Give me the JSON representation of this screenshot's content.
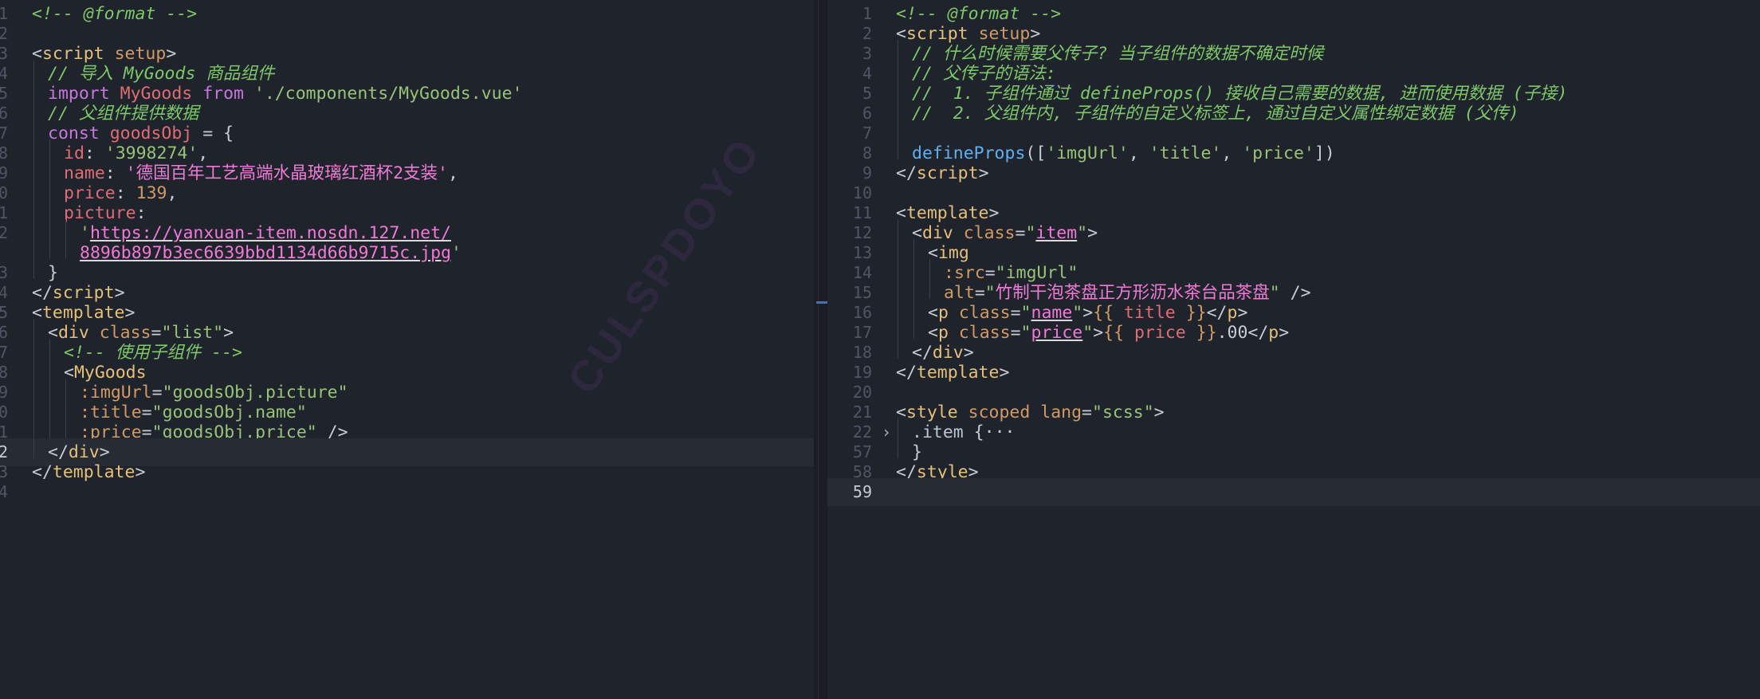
{
  "left_editor": {
    "lines": [
      {
        "num": "1",
        "indent": 0,
        "tokens": [
          {
            "t": "<!-- @format -->",
            "c": "cm"
          }
        ]
      },
      {
        "num": "2",
        "indent": 0,
        "tokens": []
      },
      {
        "num": "3",
        "indent": 0,
        "tokens": [
          {
            "t": "<",
            "c": "pn"
          },
          {
            "t": "script",
            "c": "tg"
          },
          {
            "t": " ",
            "c": "pn"
          },
          {
            "t": "setup",
            "c": "at"
          },
          {
            "t": ">",
            "c": "pn"
          }
        ]
      },
      {
        "num": "4",
        "indent": 1,
        "tokens": [
          {
            "t": "// 导入 MyGoods 商品组件",
            "c": "cm"
          }
        ]
      },
      {
        "num": "5",
        "indent": 1,
        "tokens": [
          {
            "t": "import",
            "c": "kw"
          },
          {
            "t": " ",
            "c": "pn"
          },
          {
            "t": "MyGoods",
            "c": "pr"
          },
          {
            "t": " ",
            "c": "pn"
          },
          {
            "t": "from",
            "c": "kw"
          },
          {
            "t": " ",
            "c": "pn"
          },
          {
            "t": "'./components/MyGoods.vue'",
            "c": "st"
          }
        ]
      },
      {
        "num": "6",
        "indent": 1,
        "tokens": [
          {
            "t": "// 父组件提供数据",
            "c": "cm"
          }
        ]
      },
      {
        "num": "7",
        "indent": 1,
        "tokens": [
          {
            "t": "const",
            "c": "kw"
          },
          {
            "t": " ",
            "c": "pn"
          },
          {
            "t": "goodsObj",
            "c": "pr"
          },
          {
            "t": " = {",
            "c": "pn"
          }
        ]
      },
      {
        "num": "8",
        "indent": 2,
        "tokens": [
          {
            "t": "id",
            "c": "pr"
          },
          {
            "t": ": ",
            "c": "pn"
          },
          {
            "t": "'3998274'",
            "c": "st"
          },
          {
            "t": ",",
            "c": "pn"
          }
        ]
      },
      {
        "num": "9",
        "indent": 2,
        "tokens": [
          {
            "t": "name",
            "c": "pr"
          },
          {
            "t": ": ",
            "c": "pn"
          },
          {
            "t": "'德国百年工艺高端水晶玻璃红酒杯2支装'",
            "c": "sp"
          },
          {
            "t": ",",
            "c": "pn"
          }
        ]
      },
      {
        "num": "0",
        "indent": 2,
        "tokens": [
          {
            "t": "price",
            "c": "pr"
          },
          {
            "t": ": ",
            "c": "pn"
          },
          {
            "t": "139",
            "c": "nu"
          },
          {
            "t": ",",
            "c": "pn"
          }
        ]
      },
      {
        "num": "1",
        "indent": 2,
        "tokens": [
          {
            "t": "picture",
            "c": "pr"
          },
          {
            "t": ":",
            "c": "pn"
          }
        ]
      },
      {
        "num": "2",
        "indent": 3,
        "tokens": [
          {
            "t": "'",
            "c": "st"
          },
          {
            "t": "https://yanxuan-item.nosdn.127.net/",
            "c": "sp ul"
          }
        ]
      },
      {
        "num": "",
        "indent": 3,
        "tokens": [
          {
            "t": "8896b897b3ec6639bbd1134d66b9715c.jpg",
            "c": "sp ul"
          },
          {
            "t": "'",
            "c": "st"
          }
        ]
      },
      {
        "num": "3",
        "indent": 1,
        "tokens": [
          {
            "t": "}",
            "c": "pn"
          }
        ]
      },
      {
        "num": "4",
        "indent": 0,
        "tokens": [
          {
            "t": "</",
            "c": "pn"
          },
          {
            "t": "script",
            "c": "tg"
          },
          {
            "t": ">",
            "c": "pn"
          }
        ]
      },
      {
        "num": "5",
        "indent": 0,
        "tokens": [
          {
            "t": "<",
            "c": "pn"
          },
          {
            "t": "template",
            "c": "tg"
          },
          {
            "t": ">",
            "c": "pn"
          }
        ]
      },
      {
        "num": "6",
        "indent": 1,
        "tokens": [
          {
            "t": "<",
            "c": "pn"
          },
          {
            "t": "div",
            "c": "tg"
          },
          {
            "t": " ",
            "c": "pn"
          },
          {
            "t": "class",
            "c": "at"
          },
          {
            "t": "=",
            "c": "pn"
          },
          {
            "t": "\"list\"",
            "c": "st"
          },
          {
            "t": ">",
            "c": "pn"
          }
        ]
      },
      {
        "num": "7",
        "indent": 2,
        "tokens": [
          {
            "t": "<!-- 使用子组件 -->",
            "c": "cm"
          }
        ]
      },
      {
        "num": "8",
        "indent": 2,
        "tokens": [
          {
            "t": "<",
            "c": "pn"
          },
          {
            "t": "MyGoods",
            "c": "tg"
          }
        ]
      },
      {
        "num": "9",
        "indent": 3,
        "tokens": [
          {
            "t": ":imgUrl",
            "c": "at"
          },
          {
            "t": "=",
            "c": "pn"
          },
          {
            "t": "\"goodsObj.picture\"",
            "c": "st"
          }
        ]
      },
      {
        "num": "0",
        "indent": 3,
        "tokens": [
          {
            "t": ":title",
            "c": "at"
          },
          {
            "t": "=",
            "c": "pn"
          },
          {
            "t": "\"goodsObj.name\"",
            "c": "st"
          }
        ]
      },
      {
        "num": "1",
        "indent": 3,
        "tokens": [
          {
            "t": ":price",
            "c": "at"
          },
          {
            "t": "=",
            "c": "pn"
          },
          {
            "t": "\"goodsObj.price\"",
            "c": "st"
          },
          {
            "t": " />",
            "c": "pn"
          }
        ]
      },
      {
        "num": "2",
        "indent": 1,
        "current": true,
        "tokens": [
          {
            "t": "</",
            "c": "pn"
          },
          {
            "t": "div",
            "c": "tg"
          },
          {
            "t": ">",
            "c": "pn"
          }
        ]
      },
      {
        "num": "3",
        "indent": 0,
        "tokens": [
          {
            "t": "</",
            "c": "pn"
          },
          {
            "t": "template",
            "c": "tg"
          },
          {
            "t": ">",
            "c": "pn"
          }
        ]
      },
      {
        "num": "4",
        "indent": 0,
        "tokens": []
      }
    ]
  },
  "right_editor": {
    "lines": [
      {
        "num": "1",
        "indent": 0,
        "tokens": [
          {
            "t": "<!-- @format -->",
            "c": "cm"
          }
        ]
      },
      {
        "num": "2",
        "indent": 0,
        "tokens": [
          {
            "t": "<",
            "c": "pn"
          },
          {
            "t": "script",
            "c": "tg"
          },
          {
            "t": " ",
            "c": "pn"
          },
          {
            "t": "setup",
            "c": "at"
          },
          {
            "t": ">",
            "c": "pn"
          }
        ]
      },
      {
        "num": "3",
        "indent": 1,
        "tokens": [
          {
            "t": "// 什么时候需要父传子? 当子组件的数据不确定时候",
            "c": "cm"
          }
        ]
      },
      {
        "num": "4",
        "indent": 1,
        "tokens": [
          {
            "t": "// 父传子的语法:",
            "c": "cm"
          }
        ]
      },
      {
        "num": "5",
        "indent": 1,
        "tokens": [
          {
            "t": "//  1. 子组件通过 defineProps() 接收自己需要的数据, 进而使用数据 (子接)",
            "c": "cm"
          }
        ]
      },
      {
        "num": "6",
        "indent": 1,
        "tokens": [
          {
            "t": "//  2. 父组件内, 子组件的自定义标签上, 通过自定义属性绑定数据 (父传)",
            "c": "cm"
          }
        ]
      },
      {
        "num": "7",
        "indent": 1,
        "tokens": []
      },
      {
        "num": "8",
        "indent": 1,
        "tokens": [
          {
            "t": "defineProps",
            "c": "fn"
          },
          {
            "t": "([",
            "c": "pn"
          },
          {
            "t": "'imgUrl'",
            "c": "st"
          },
          {
            "t": ", ",
            "c": "pn"
          },
          {
            "t": "'title'",
            "c": "st"
          },
          {
            "t": ", ",
            "c": "pn"
          },
          {
            "t": "'price'",
            "c": "st"
          },
          {
            "t": "])",
            "c": "pn"
          }
        ]
      },
      {
        "num": "9",
        "indent": 0,
        "tokens": [
          {
            "t": "</",
            "c": "pn"
          },
          {
            "t": "script",
            "c": "tg"
          },
          {
            "t": ">",
            "c": "pn"
          }
        ]
      },
      {
        "num": "10",
        "indent": 0,
        "tokens": []
      },
      {
        "num": "11",
        "indent": 0,
        "tokens": [
          {
            "t": "<",
            "c": "pn"
          },
          {
            "t": "template",
            "c": "tg"
          },
          {
            "t": ">",
            "c": "pn"
          }
        ]
      },
      {
        "num": "12",
        "indent": 1,
        "tokens": [
          {
            "t": "<",
            "c": "pn"
          },
          {
            "t": "div",
            "c": "tg"
          },
          {
            "t": " ",
            "c": "pn"
          },
          {
            "t": "class",
            "c": "at"
          },
          {
            "t": "=",
            "c": "pn"
          },
          {
            "t": "\"",
            "c": "st"
          },
          {
            "t": "item",
            "c": "sp ul"
          },
          {
            "t": "\"",
            "c": "st"
          },
          {
            "t": ">",
            "c": "pn"
          }
        ]
      },
      {
        "num": "13",
        "indent": 2,
        "tokens": [
          {
            "t": "<",
            "c": "pn"
          },
          {
            "t": "img",
            "c": "tg"
          }
        ]
      },
      {
        "num": "14",
        "indent": 3,
        "tokens": [
          {
            "t": ":src",
            "c": "at"
          },
          {
            "t": "=",
            "c": "pn"
          },
          {
            "t": "\"imgUrl\"",
            "c": "st"
          }
        ]
      },
      {
        "num": "15",
        "indent": 3,
        "tokens": [
          {
            "t": "alt",
            "c": "at"
          },
          {
            "t": "=",
            "c": "pn"
          },
          {
            "t": "\"",
            "c": "st"
          },
          {
            "t": "竹制干泡茶盘正方形沥水茶台品茶盘",
            "c": "sp"
          },
          {
            "t": "\"",
            "c": "st"
          },
          {
            "t": " />",
            "c": "pn"
          }
        ]
      },
      {
        "num": "16",
        "indent": 2,
        "tokens": [
          {
            "t": "<",
            "c": "pn"
          },
          {
            "t": "p",
            "c": "tg"
          },
          {
            "t": " ",
            "c": "pn"
          },
          {
            "t": "class",
            "c": "at"
          },
          {
            "t": "=",
            "c": "pn"
          },
          {
            "t": "\"",
            "c": "st"
          },
          {
            "t": "name",
            "c": "sp ul"
          },
          {
            "t": "\"",
            "c": "st"
          },
          {
            "t": ">",
            "c": "pn"
          },
          {
            "t": "{{ ",
            "c": "at"
          },
          {
            "t": "title",
            "c": "pr"
          },
          {
            "t": " }}",
            "c": "at"
          },
          {
            "t": "</",
            "c": "pn"
          },
          {
            "t": "p",
            "c": "tg"
          },
          {
            "t": ">",
            "c": "pn"
          }
        ]
      },
      {
        "num": "17",
        "indent": 2,
        "tokens": [
          {
            "t": "<",
            "c": "pn"
          },
          {
            "t": "p",
            "c": "tg"
          },
          {
            "t": " ",
            "c": "pn"
          },
          {
            "t": "class",
            "c": "at"
          },
          {
            "t": "=",
            "c": "pn"
          },
          {
            "t": "\"",
            "c": "st"
          },
          {
            "t": "price",
            "c": "sp ul"
          },
          {
            "t": "\"",
            "c": "st"
          },
          {
            "t": ">",
            "c": "pn"
          },
          {
            "t": "{{ ",
            "c": "at"
          },
          {
            "t": "price",
            "c": "pr"
          },
          {
            "t": " }}",
            "c": "at"
          },
          {
            "t": ".00",
            "c": "pn"
          },
          {
            "t": "</",
            "c": "pn"
          },
          {
            "t": "p",
            "c": "tg"
          },
          {
            "t": ">",
            "c": "pn"
          }
        ]
      },
      {
        "num": "18",
        "indent": 1,
        "tokens": [
          {
            "t": "</",
            "c": "pn"
          },
          {
            "t": "div",
            "c": "tg"
          },
          {
            "t": ">",
            "c": "pn"
          }
        ]
      },
      {
        "num": "19",
        "indent": 0,
        "tokens": [
          {
            "t": "</",
            "c": "pn"
          },
          {
            "t": "template",
            "c": "tg"
          },
          {
            "t": ">",
            "c": "pn"
          }
        ]
      },
      {
        "num": "20",
        "indent": 0,
        "tokens": []
      },
      {
        "num": "21",
        "indent": 0,
        "tokens": [
          {
            "t": "<",
            "c": "pn"
          },
          {
            "t": "style",
            "c": "tg"
          },
          {
            "t": " ",
            "c": "pn"
          },
          {
            "t": "scoped",
            "c": "at"
          },
          {
            "t": " ",
            "c": "pn"
          },
          {
            "t": "lang",
            "c": "at"
          },
          {
            "t": "=",
            "c": "pn"
          },
          {
            "t": "\"scss\"",
            "c": "st"
          },
          {
            "t": ">",
            "c": "pn"
          }
        ]
      },
      {
        "num": "22",
        "indent": 1,
        "fold": true,
        "tokens": [
          {
            "t": ".item",
            "c": "cy"
          },
          {
            "t": " {",
            "c": "pn"
          },
          {
            "t": "···",
            "c": "pn"
          }
        ]
      },
      {
        "num": "57",
        "indent": 1,
        "tokens": [
          {
            "t": "}",
            "c": "pn"
          }
        ]
      },
      {
        "num": "58",
        "indent": 0,
        "tokens": [
          {
            "t": "</",
            "c": "pn"
          },
          {
            "t": "style",
            "c": "tg"
          },
          {
            "t": ">",
            "c": "pn"
          }
        ]
      },
      {
        "num": "59",
        "indent": 0,
        "current": true,
        "tokens": []
      }
    ]
  },
  "watermark": "CULSPDOYO",
  "fold_glyph": "›"
}
